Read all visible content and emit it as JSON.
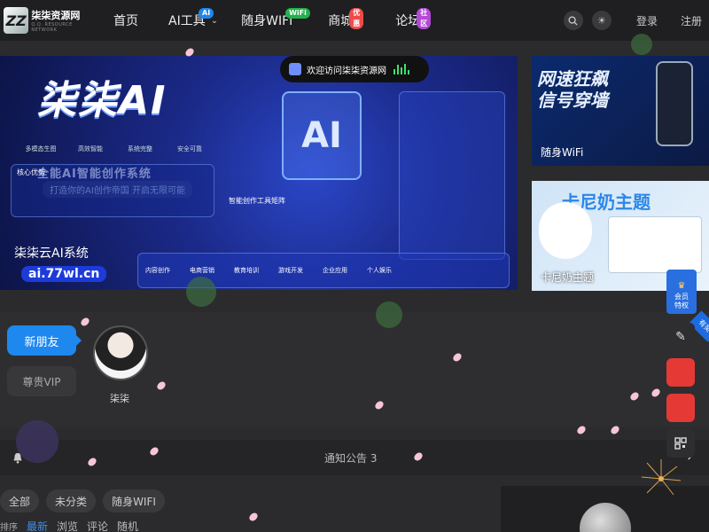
{
  "logo": {
    "mark": "ZZ",
    "name": "柒柒资源网",
    "tagline": "Q.Q. RESOURCE NETWORK"
  },
  "nav": [
    {
      "label": "首页",
      "badge": null
    },
    {
      "label": "AI工具",
      "badge": "AI",
      "badge_color": "#1e88ef",
      "dropdown": true
    },
    {
      "label": "随身WIFI",
      "badge": "WiFi",
      "badge_color": "#22b14c"
    },
    {
      "label": "商城",
      "badge": "优惠",
      "badge_color": "#ef4a4a"
    },
    {
      "label": "论坛",
      "badge": "社区",
      "badge_color": "#b24ad6"
    }
  ],
  "header_actions": {
    "login": "登录",
    "register": "注册"
  },
  "welcome_toast": "欢迎访问柒柒资源网",
  "main_banner": {
    "title": "柒柒AI",
    "subtitle": "全能AI智能创作系统",
    "slogan": "打造你的AI创作帝国 开启无限可能",
    "features": [
      "多模态生图",
      "高效智能",
      "系统完整",
      "安全可靠"
    ],
    "advantages": "核心优势",
    "tools_title": "智能创作工具矩阵",
    "ai_box": "AI",
    "scenes": [
      "内容创作",
      "电商营销",
      "教育培训",
      "游戏开发",
      "企业应用",
      "个人娱乐"
    ],
    "caption": "柒柒云AI系统",
    "url": "ai.77wl.cn"
  },
  "side_banners": [
    {
      "title": "网速狂飙\n信号穿墙",
      "caption": "随身WiFi"
    },
    {
      "title": "卡尼奶主题",
      "caption": "卡尼奶主题"
    }
  ],
  "member": {
    "new_friend": "新朋友",
    "vip": "尊贵VIP",
    "user_name": "柒柒"
  },
  "notice": {
    "text": "通知公告 3"
  },
  "categories": [
    "全部",
    "未分类",
    "随身WIFI"
  ],
  "sort": {
    "label": "排序",
    "options": [
      "最新",
      "浏览",
      "评论",
      "随机"
    ]
  },
  "floating": {
    "member_badge": "会员\n特权",
    "ribbon": "有奖"
  },
  "colors": {
    "accent": "#1e88ef",
    "danger": "#e53935",
    "bg": "#2b2b2d"
  }
}
